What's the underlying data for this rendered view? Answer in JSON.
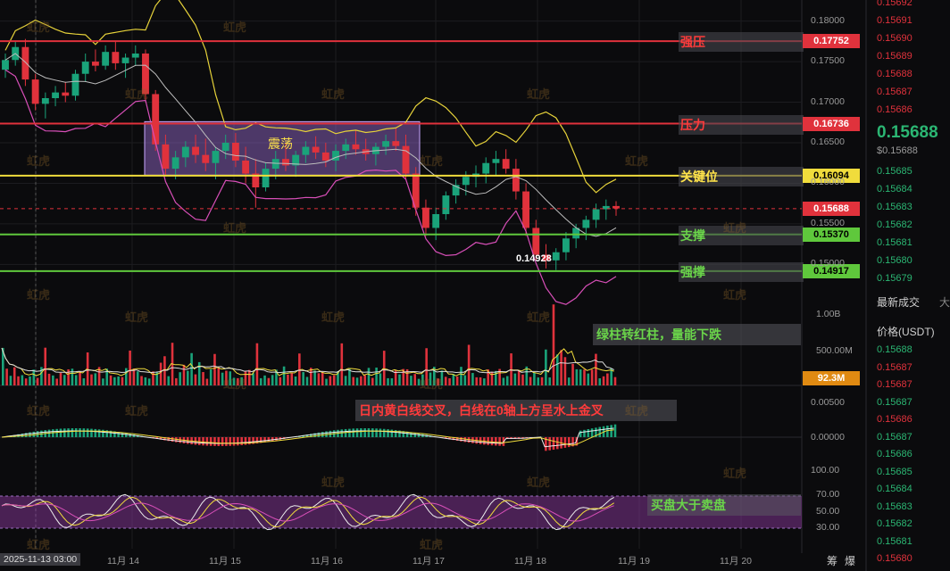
{
  "ui": {
    "box_label": "震荡",
    "low_marker": "0.14928",
    "levels": [
      {
        "name": "强压",
        "price": 0.17752,
        "tag": "0.17752",
        "color": "#e0323c",
        "tagColor": "#e0323c",
        "textColor": "#ff3b3b"
      },
      {
        "name": "压力",
        "price": 0.16736,
        "tag": "0.16736",
        "color": "#e0323c",
        "tagColor": "#e0323c",
        "textColor": "#ff3b3b"
      },
      {
        "name": "关键位",
        "price": 0.16094,
        "tag": "0.16094",
        "color": "#f0dc3c",
        "tagColor": "#f0dc3c",
        "textColor": "#ffe34a"
      },
      {
        "name": "支撑",
        "price": 0.1537,
        "tag": "0.15370",
        "color": "#5fc83c",
        "tagColor": "#5fc83c",
        "textColor": "#6ad44a"
      },
      {
        "name": "强撑",
        "price": 0.14917,
        "tag": "0.14917",
        "color": "#5fc83c",
        "tagColor": "#5fc83c",
        "textColor": "#6ad44a"
      }
    ],
    "current_tag": "0.15688",
    "volume_tag": "92.3M",
    "notes": {
      "volume": "绿柱转红柱，量能下跌",
      "macd": "日内黄白线交叉，白线在0轴上方呈水上金叉",
      "rsi": "买盘大于卖盘"
    },
    "watermark": "虹虎",
    "price_axis": [
      "0.18000",
      "0.17500",
      "0.17000",
      "0.16500",
      "0.16000",
      "0.15500",
      "0.15000"
    ],
    "volume_axis": [
      "1.00B",
      "500.00M"
    ],
    "macd_axis": [
      "0.00500",
      "0.00000",
      "100.00"
    ],
    "rsi_axis": [
      "70.00",
      "50.00",
      "30.00"
    ],
    "time_axis": [
      "2025-11-13 03:00",
      "11月 14",
      "11月 15",
      "11月 16",
      "11月 17",
      "11月 18",
      "11月 19",
      "11月 20"
    ],
    "bottom_right": [
      "筹",
      "爆"
    ]
  },
  "sidebar": {
    "asks": [
      "0.15692",
      "0.15691",
      "0.15690",
      "0.15689",
      "0.15688",
      "0.15687",
      "0.15686"
    ],
    "last_price": "0.15688",
    "last_price_usd": "$0.15688",
    "bids": [
      "0.15685",
      "0.15684",
      "0.15683",
      "0.15682",
      "0.15681",
      "0.15680",
      "0.15679"
    ],
    "trades_title": "最新成交",
    "trades_title2": "大",
    "price_header": "价格(USDT)",
    "trades": [
      {
        "p": "0.15688",
        "c": "g"
      },
      {
        "p": "0.15687",
        "c": "r"
      },
      {
        "p": "0.15687",
        "c": "r"
      },
      {
        "p": "0.15687",
        "c": "g"
      },
      {
        "p": "0.15686",
        "c": "r"
      },
      {
        "p": "0.15687",
        "c": "g"
      },
      {
        "p": "0.15686",
        "c": "g"
      },
      {
        "p": "0.15685",
        "c": "g"
      },
      {
        "p": "0.15684",
        "c": "g"
      },
      {
        "p": "0.15683",
        "c": "g"
      },
      {
        "p": "0.15682",
        "c": "g"
      },
      {
        "p": "0.15681",
        "c": "g"
      },
      {
        "p": "0.15680",
        "c": "r"
      }
    ]
  },
  "chart_data": {
    "type": "candlestick",
    "title": "",
    "xlabel": "",
    "ylabel": "",
    "ylim": [
      0.1485,
      0.1815
    ],
    "x_range": [
      "2025-11-13 03:00",
      "2025-11-20"
    ],
    "candles_ohlc": [
      [
        0.174,
        0.176,
        0.173,
        0.1752
      ],
      [
        0.1752,
        0.1775,
        0.1745,
        0.1768
      ],
      [
        0.1768,
        0.1778,
        0.172,
        0.1728
      ],
      [
        0.1728,
        0.1735,
        0.169,
        0.1698
      ],
      [
        0.1698,
        0.1712,
        0.168,
        0.1705
      ],
      [
        0.1705,
        0.172,
        0.1695,
        0.1712
      ],
      [
        0.1712,
        0.1725,
        0.17,
        0.1708
      ],
      [
        0.1708,
        0.174,
        0.1702,
        0.1735
      ],
      [
        0.1735,
        0.176,
        0.1725,
        0.175
      ],
      [
        0.175,
        0.1765,
        0.1738,
        0.1745
      ],
      [
        0.1745,
        0.177,
        0.174,
        0.1762
      ],
      [
        0.1762,
        0.1775,
        0.174,
        0.1748
      ],
      [
        0.1748,
        0.176,
        0.173,
        0.1755
      ],
      [
        0.1755,
        0.177,
        0.1745,
        0.176
      ],
      [
        0.176,
        0.1765,
        0.17,
        0.171
      ],
      [
        0.171,
        0.1715,
        0.164,
        0.1648
      ],
      [
        0.1648,
        0.166,
        0.161,
        0.1618
      ],
      [
        0.1618,
        0.164,
        0.1605,
        0.1632
      ],
      [
        0.1632,
        0.1652,
        0.162,
        0.1645
      ],
      [
        0.1645,
        0.166,
        0.1625,
        0.1635
      ],
      [
        0.1635,
        0.1655,
        0.1615,
        0.1625
      ],
      [
        0.1625,
        0.1645,
        0.1605,
        0.164
      ],
      [
        0.164,
        0.166,
        0.163,
        0.165
      ],
      [
        0.165,
        0.1662,
        0.162,
        0.1628
      ],
      [
        0.1628,
        0.1645,
        0.16,
        0.1612
      ],
      [
        0.1612,
        0.163,
        0.157,
        0.1595
      ],
      [
        0.1595,
        0.1625,
        0.159,
        0.1618
      ],
      [
        0.1618,
        0.164,
        0.1605,
        0.163
      ],
      [
        0.163,
        0.165,
        0.1615,
        0.1622
      ],
      [
        0.1622,
        0.164,
        0.1608,
        0.1635
      ],
      [
        0.1635,
        0.1652,
        0.1625,
        0.1645
      ],
      [
        0.1645,
        0.1658,
        0.163,
        0.1638
      ],
      [
        0.1638,
        0.165,
        0.162,
        0.1628
      ],
      [
        0.1628,
        0.1648,
        0.1615,
        0.164
      ],
      [
        0.164,
        0.1655,
        0.163,
        0.1648
      ],
      [
        0.1648,
        0.1665,
        0.1635,
        0.1642
      ],
      [
        0.1642,
        0.1655,
        0.1628,
        0.1636
      ],
      [
        0.1636,
        0.165,
        0.1622,
        0.1645
      ],
      [
        0.1645,
        0.166,
        0.1635,
        0.1652
      ],
      [
        0.1652,
        0.1668,
        0.164,
        0.1646
      ],
      [
        0.1646,
        0.166,
        0.1605,
        0.1612
      ],
      [
        0.1612,
        0.162,
        0.156,
        0.157
      ],
      [
        0.157,
        0.158,
        0.1535,
        0.1545
      ],
      [
        0.1545,
        0.157,
        0.153,
        0.1562
      ],
      [
        0.1562,
        0.159,
        0.1555,
        0.1585
      ],
      [
        0.1585,
        0.1605,
        0.1575,
        0.1598
      ],
      [
        0.1598,
        0.1615,
        0.1585,
        0.1608
      ],
      [
        0.1608,
        0.1622,
        0.1595,
        0.1612
      ],
      [
        0.1612,
        0.1632,
        0.16,
        0.1625
      ],
      [
        0.1625,
        0.164,
        0.161,
        0.163
      ],
      [
        0.163,
        0.1642,
        0.1612,
        0.1618
      ],
      [
        0.1618,
        0.163,
        0.158,
        0.159
      ],
      [
        0.159,
        0.16,
        0.1535,
        0.1545
      ],
      [
        0.1545,
        0.1555,
        0.1505,
        0.1512
      ],
      [
        0.1512,
        0.1525,
        0.1495,
        0.1505
      ],
      [
        0.1505,
        0.152,
        0.1493,
        0.1515
      ],
      [
        0.1515,
        0.154,
        0.1505,
        0.1532
      ],
      [
        0.1532,
        0.155,
        0.152,
        0.1545
      ],
      [
        0.1545,
        0.156,
        0.153,
        0.1555
      ],
      [
        0.1555,
        0.1575,
        0.1545,
        0.1568
      ],
      [
        0.1568,
        0.158,
        0.1555,
        0.1572
      ],
      [
        0.1572,
        0.1578,
        0.156,
        0.1569
      ]
    ]
  }
}
